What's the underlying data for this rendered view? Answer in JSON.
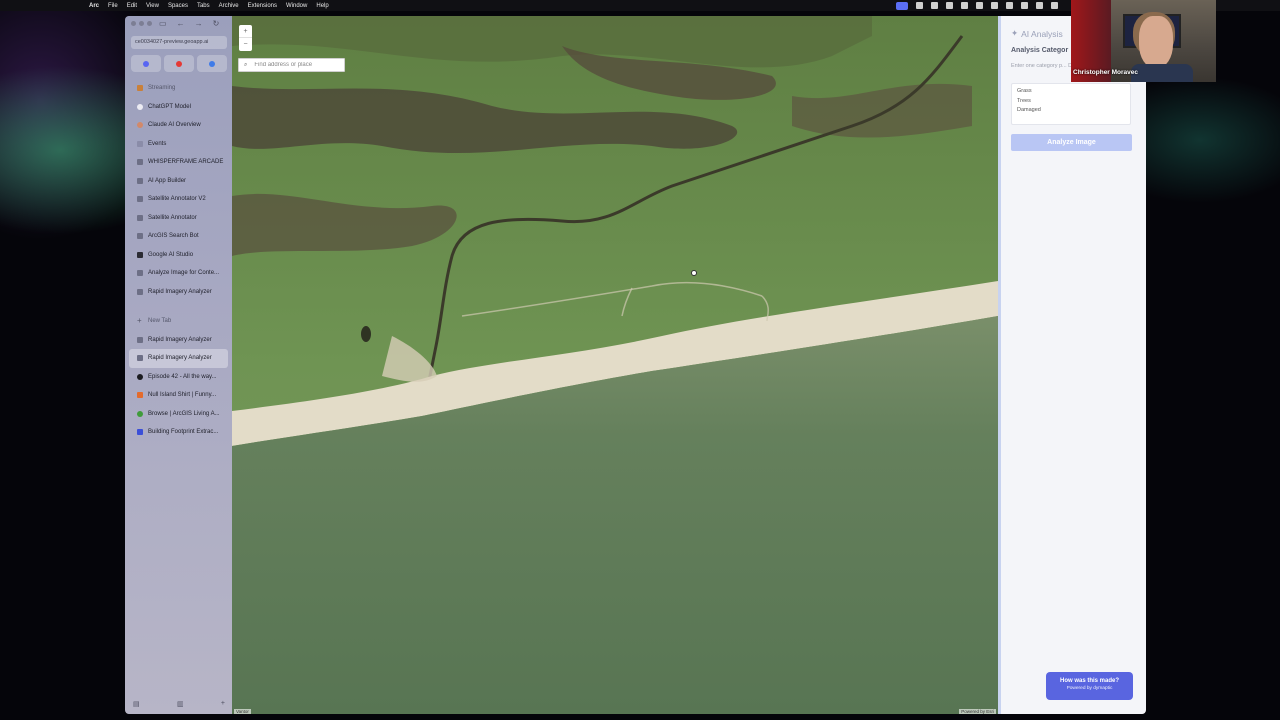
{
  "menubar": {
    "items": [
      "Arc",
      "File",
      "Edit",
      "View",
      "Spaces",
      "Tabs",
      "Archive",
      "Extensions",
      "Window",
      "Help"
    ]
  },
  "browser": {
    "url": "ce0034027-preview.geoapp.ai",
    "sidebar": {
      "section_header": "Streaming",
      "pinned": [
        {
          "label": "ChatGPT Model",
          "icon": "chatgpt-icon"
        },
        {
          "label": "Claude AI Overview",
          "icon": "claude-icon"
        },
        {
          "label": "Events",
          "icon": "calendar-icon"
        },
        {
          "label": "WHISPERFRAME ARCADE",
          "icon": "page-icon"
        },
        {
          "label": "AI App Builder",
          "icon": "page-icon"
        },
        {
          "label": "Satellite Annotator V2",
          "icon": "page-icon"
        },
        {
          "label": "Satellite Annotator",
          "icon": "page-icon"
        },
        {
          "label": "ArcGIS Search Bot",
          "icon": "page-icon"
        },
        {
          "label": "Google AI Studio",
          "icon": "google-icon"
        },
        {
          "label": "Analyze Image for Conte...",
          "icon": "page-icon"
        },
        {
          "label": "Rapid Imagery Analyzer",
          "icon": "page-icon"
        }
      ],
      "new_tab_label": "New Tab",
      "tabs": [
        {
          "label": "Rapid Imagery Analyzer",
          "icon": "page-icon",
          "active": false
        },
        {
          "label": "Rapid Imagery Analyzer",
          "icon": "page-icon",
          "active": true
        },
        {
          "label": "Episode 42 - All the way...",
          "icon": "podcast-icon",
          "active": false
        },
        {
          "label": "Null Island Shirt | Funny...",
          "icon": "shop-icon",
          "active": false
        },
        {
          "label": "Browse | ArcGIS Living A...",
          "icon": "arcgis-icon",
          "active": false
        },
        {
          "label": "Building Footprint Extrac...",
          "icon": "page-icon",
          "active": false
        }
      ]
    }
  },
  "map": {
    "search_placeholder": "Find address or place",
    "zoom_in": "+",
    "zoom_out": "−",
    "attribution_left": "Vantor",
    "attribution_right": "Powered by Esri",
    "colors": {
      "land": "#6b8a54",
      "sand": "#e3dcc8",
      "water": "#5f7a5a",
      "dark_wet": "#4c4638"
    }
  },
  "panel": {
    "title": "AI Analysis",
    "categories_label": "Analysis Categor",
    "hint": "Enter one category p... Damaged, Grass, Tre...",
    "categories": [
      "Grass",
      "Trees",
      "Damaged"
    ],
    "analyze_button": "Analyze Image",
    "made_line1": "How was this made?",
    "made_line2": "Powered by dymaptic"
  },
  "webcam": {
    "name": "Christopher Moravec"
  }
}
